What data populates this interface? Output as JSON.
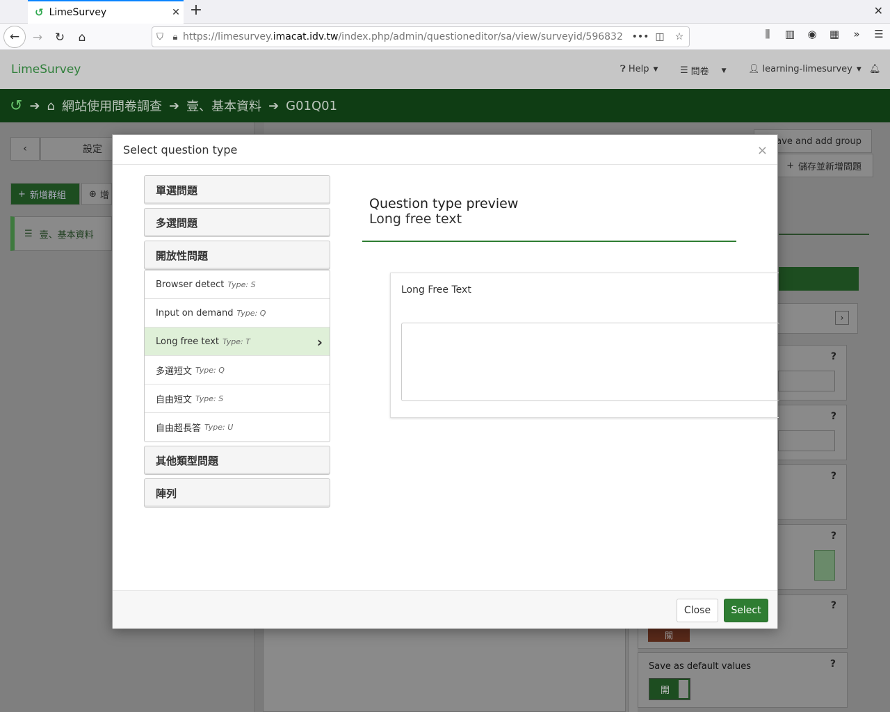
{
  "browser": {
    "tab_title": "LimeSurvey",
    "url_host_prefix": "https://limesurvey.",
    "url_host_main": "imacat.idv.tw",
    "url_path": "/index.php/admin/questioneditor/sa/view/surveyid/596832"
  },
  "app": {
    "brand": "LimeSurvey",
    "help_label": "Help",
    "surveys_label": "問卷",
    "user_label": "learning-limesurvey"
  },
  "breadcrumb": {
    "survey": "網站使用問卷調查",
    "group": "壹、基本資料",
    "question": "G01Q01"
  },
  "background": {
    "settings_label": "設定",
    "add_group_label": "新增群組",
    "add_question_partial": "增",
    "group_item": "壹、基本資料",
    "save_add_group": "Save and add group",
    "save_add_question": "儲存並新增問題",
    "save_default_label": "Save as default values",
    "toggle_on": "開",
    "toggle_off": "關"
  },
  "modal": {
    "title": "Select question type",
    "categories": {
      "single": "單選問題",
      "multiple": "多選問題",
      "open": "開放性問題",
      "other": "其他類型問題",
      "array": "陣列"
    },
    "open_items": [
      {
        "label": "Browser detect",
        "type": "Type: S"
      },
      {
        "label": "Input on demand",
        "type": "Type: Q"
      },
      {
        "label": "Long free text",
        "type": "Type: T"
      },
      {
        "label": "多選短文",
        "type": "Type: Q"
      },
      {
        "label": "自由短文",
        "type": "Type: S"
      },
      {
        "label": "自由超長答",
        "type": "Type: U"
      }
    ],
    "preview_heading": "Question type preview",
    "preview_type": "Long free text",
    "question_text": "Long Free Text",
    "close_label": "Close",
    "select_label": "Select"
  }
}
